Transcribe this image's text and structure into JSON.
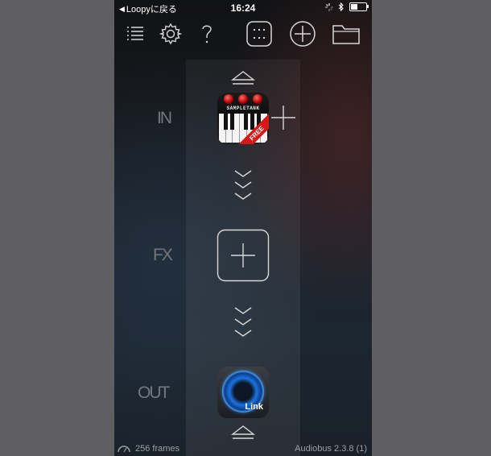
{
  "statusbar": {
    "back_label": "Loopyに戻る",
    "time": "16:24",
    "battery_level": 0.45
  },
  "toolbar": {
    "icons": [
      "list-icon",
      "gear-icon",
      "help-icon",
      "grid-icon",
      "add-circle-icon",
      "folder-icon"
    ]
  },
  "rows": {
    "in_label": "IN",
    "fx_label": "FX",
    "out_label": "OUT"
  },
  "apps": {
    "input_app_name": "SAMPLETANK",
    "input_app_badge": "FREE",
    "output_app_badge": "Link"
  },
  "footer": {
    "frames": "256 frames",
    "version": "Audiobus 2.3.8 (1)"
  },
  "colors": {
    "accent": "#1a74e0",
    "free_badge": "#d61818",
    "icon_stroke": "#d8d8d8"
  }
}
